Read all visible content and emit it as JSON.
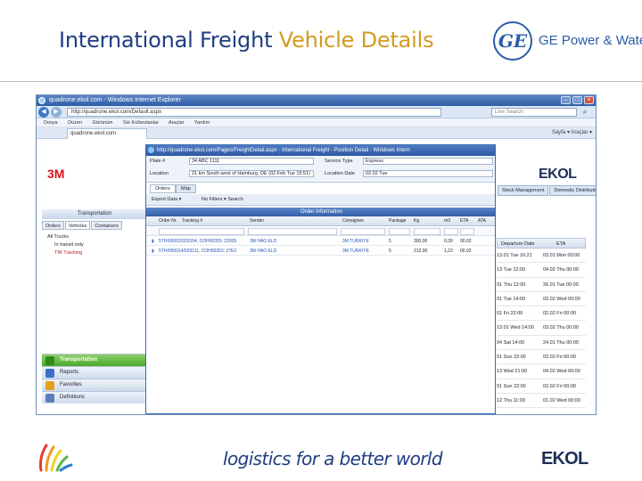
{
  "slide": {
    "title_main": "International Freight",
    "title_accent": "Vehicle Details",
    "ge_logo_text": "GE",
    "ge_brand": "GE Power & Water",
    "footer_tagline": "logistics for a better world",
    "footer_logo": "EKOL"
  },
  "browser": {
    "window_title": "quadrone.ekol.com - Windows Internet Explorer",
    "address": "http://quadrone.ekol.com/Default.aspx",
    "search_placeholder": "Live Search",
    "menu": [
      "Dosya",
      "Düzen",
      "Görünüm",
      "Sık Kullanılanlar",
      "Araçlar",
      "Yardım"
    ],
    "tab_label": "quadrone.ekol.com",
    "tools": "Sayfa ▾  Araçlar ▾"
  },
  "app": {
    "client_logo": "3M",
    "brand_logo": "EKOL",
    "left_panel_title": "Transportation",
    "left_tabs": [
      "Orders",
      "Vehicles",
      "Containers"
    ],
    "tree": [
      "All Trucks",
      "In transit only",
      "TIR Tracking"
    ],
    "accordion": [
      "Transportation",
      "Reports",
      "Favorites",
      "Definitions"
    ],
    "top_nav": [
      "Stock Management",
      "Domestic Distribution"
    ],
    "grid": {
      "columns": [
        "Departure Date",
        "ETA"
      ],
      "rows": [
        [
          "13.01 Tue 16:21",
          "03.01 Mon 00:00"
        ],
        [
          "13 Tue 12:00",
          "04.02 Thu 00:00"
        ],
        [
          "01 Thu 12:00",
          "26.01 Tue 00:00"
        ],
        [
          "01 Tue 14:00",
          "02.02 Wed 00:00"
        ],
        [
          "01 Fri 22:00",
          "02.02 Fri 00:00"
        ],
        [
          "13.01 Wed 14:00",
          "03.02 Thu 00:00"
        ],
        [
          "04 Sat 14:00",
          "24.01 Thu 00:00"
        ],
        [
          "01 Sun 22:00",
          "02.02 Fri 00:00"
        ],
        [
          "13 Wed 21:00",
          "04.02 Wed 00:00"
        ],
        [
          "01 Sun 22:00",
          "02.02 Fri 00:00"
        ],
        [
          "12 Thu 11:00",
          "01.02 Wed 00:00"
        ]
      ]
    }
  },
  "popup": {
    "title": "http://quadrone.ekol.com/Pages/FreightDetail.aspx - International Freight - Position Detail - Windows Intern",
    "fields": {
      "plate_label": "Plate #",
      "plate_value": "34 ABC 1111",
      "service_label": "Service Type",
      "service_value": "Express",
      "location_label": "Location",
      "location_value": "21 km South west of Hamburg, DE (02 Feb Tue 15:51)",
      "location_date_label": "Location Date",
      "location_date_value": "02.02 Tue"
    },
    "tabs": [
      "Orders",
      "Map"
    ],
    "toolbar": [
      "Export Data ▾",
      "No Filters ▾ Search"
    ],
    "order_info_title": "Order Information",
    "columns": [
      "Order Nr.",
      "Tracking #",
      "Sender",
      "Consignee",
      "Package",
      "Kg",
      "m3",
      "ETA",
      "ATA"
    ],
    "rows": [
      [
        "5TH/00002/029104, COH00355",
        "22005",
        "3M HAO ELD",
        "3M TURKIYE",
        "5",
        "300,00",
        "0,39",
        "00.02"
      ],
      [
        "5TH/000014/029111, COH00353",
        "27E0",
        "3M HAO ELD",
        "3M TURKIYE",
        "5",
        "212,00",
        "1,23",
        "00.02"
      ]
    ]
  }
}
